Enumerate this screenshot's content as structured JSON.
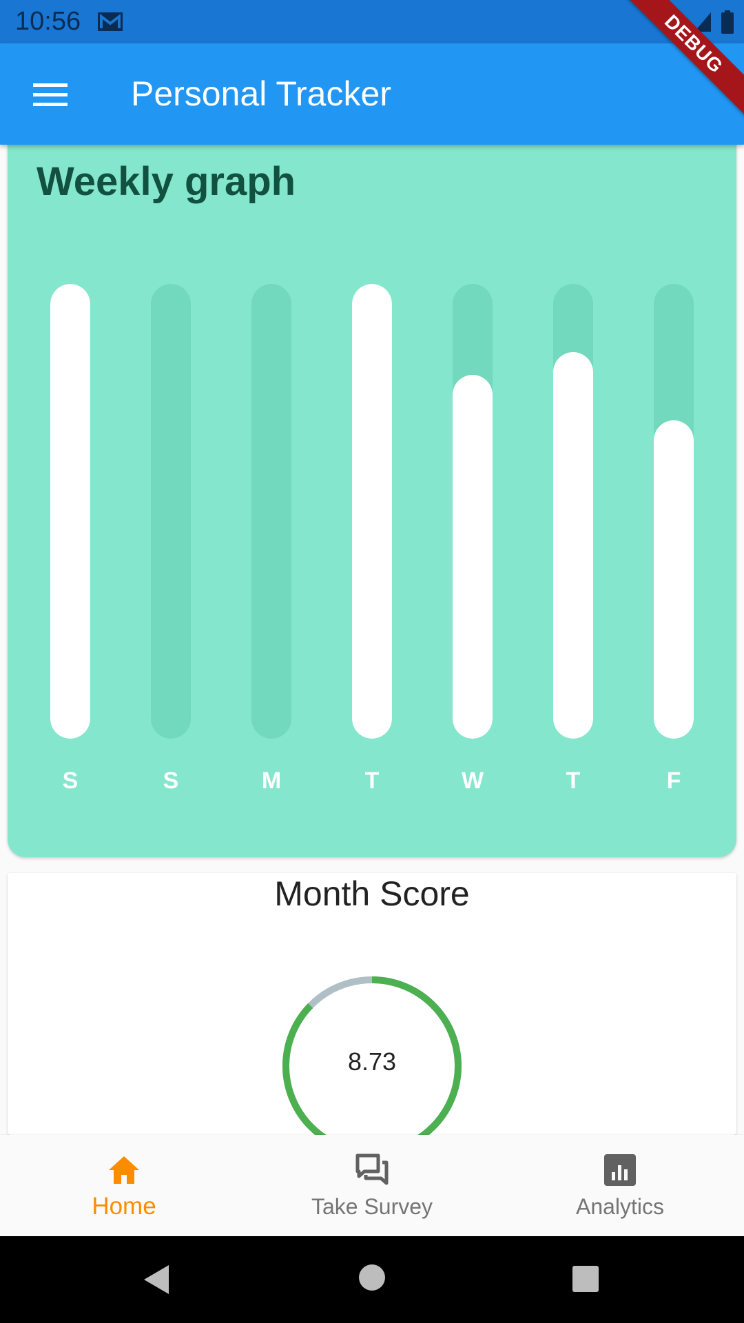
{
  "status_bar": {
    "time": "10:56",
    "icons": [
      "mail-icon",
      "wifi-icon",
      "signal-icon",
      "battery-icon"
    ]
  },
  "debug_banner": "DEBUG",
  "app_bar": {
    "title": "Personal Tracker",
    "menu_icon": "hamburger-menu-icon"
  },
  "weekly_graph": {
    "title": "Weekly graph",
    "days": [
      "S",
      "S",
      "M",
      "T",
      "W",
      "T",
      "F"
    ],
    "fill_levels": [
      1.0,
      0.0,
      0.0,
      1.0,
      0.8,
      0.85,
      0.7
    ],
    "colors": {
      "card": "#84e6cd",
      "track": "#72d9be",
      "fill": "#ffffff",
      "title": "#12503f"
    }
  },
  "month_score": {
    "title": "Month Score",
    "value": "8.73",
    "progress": 0.873,
    "colors": {
      "progress": "#4caf50",
      "remainder": "#b0bec5"
    }
  },
  "bottom_nav": {
    "items": [
      {
        "label": "Home",
        "icon": "home-icon",
        "active": true
      },
      {
        "label": "Take Survey",
        "icon": "chat-bubbles-icon",
        "active": false
      },
      {
        "label": "Analytics",
        "icon": "bar-chart-icon",
        "active": false
      }
    ],
    "colors": {
      "active": "#fb8c00",
      "inactive": "#757575"
    }
  },
  "system_nav": {
    "icons": [
      "back-icon",
      "home-circle-icon",
      "recents-icon"
    ]
  },
  "colors": {
    "status_bar": "#1976d2",
    "app_bar": "#2196f3"
  }
}
